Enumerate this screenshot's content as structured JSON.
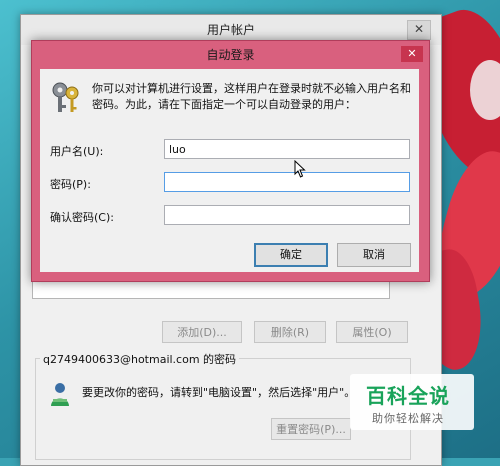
{
  "background_window": {
    "title": "用户帐户",
    "close_glyph": "✕",
    "buttons": {
      "add": "添加(D)...",
      "remove": "删除(R)",
      "properties": "属性(O)"
    },
    "password_group_title": "q2749400633@hotmail.com 的密码",
    "change_text": "要更改你的密码，请转到\"电脑设置\"，然后选择\"用户\"。",
    "reset_button": "重置密码(P)..."
  },
  "dialog": {
    "title": "自动登录",
    "close_glyph": "✕",
    "intro": "你可以对计算机进行设置，这样用户在登录时就不必输入用户名和密码。为此，请在下面指定一个可以自动登录的用户：",
    "username_label": "用户名(U):",
    "username_value": "luo",
    "password_label": "密码(P):",
    "password_value": "",
    "confirm_label": "确认密码(C):",
    "confirm_value": "",
    "ok_label": "确定",
    "cancel_label": "取消"
  },
  "watermark": {
    "main": "百科全说",
    "sub": "助你轻松解决"
  },
  "icons": {
    "dialog_icon": "keys-icon",
    "user_icon": "user-icon",
    "cursor": "mouse-cursor-icon"
  },
  "colors": {
    "dialog_frame": "#d9607e",
    "default_button_border": "#3c7fb1",
    "watermark_green": "#19a35a"
  }
}
